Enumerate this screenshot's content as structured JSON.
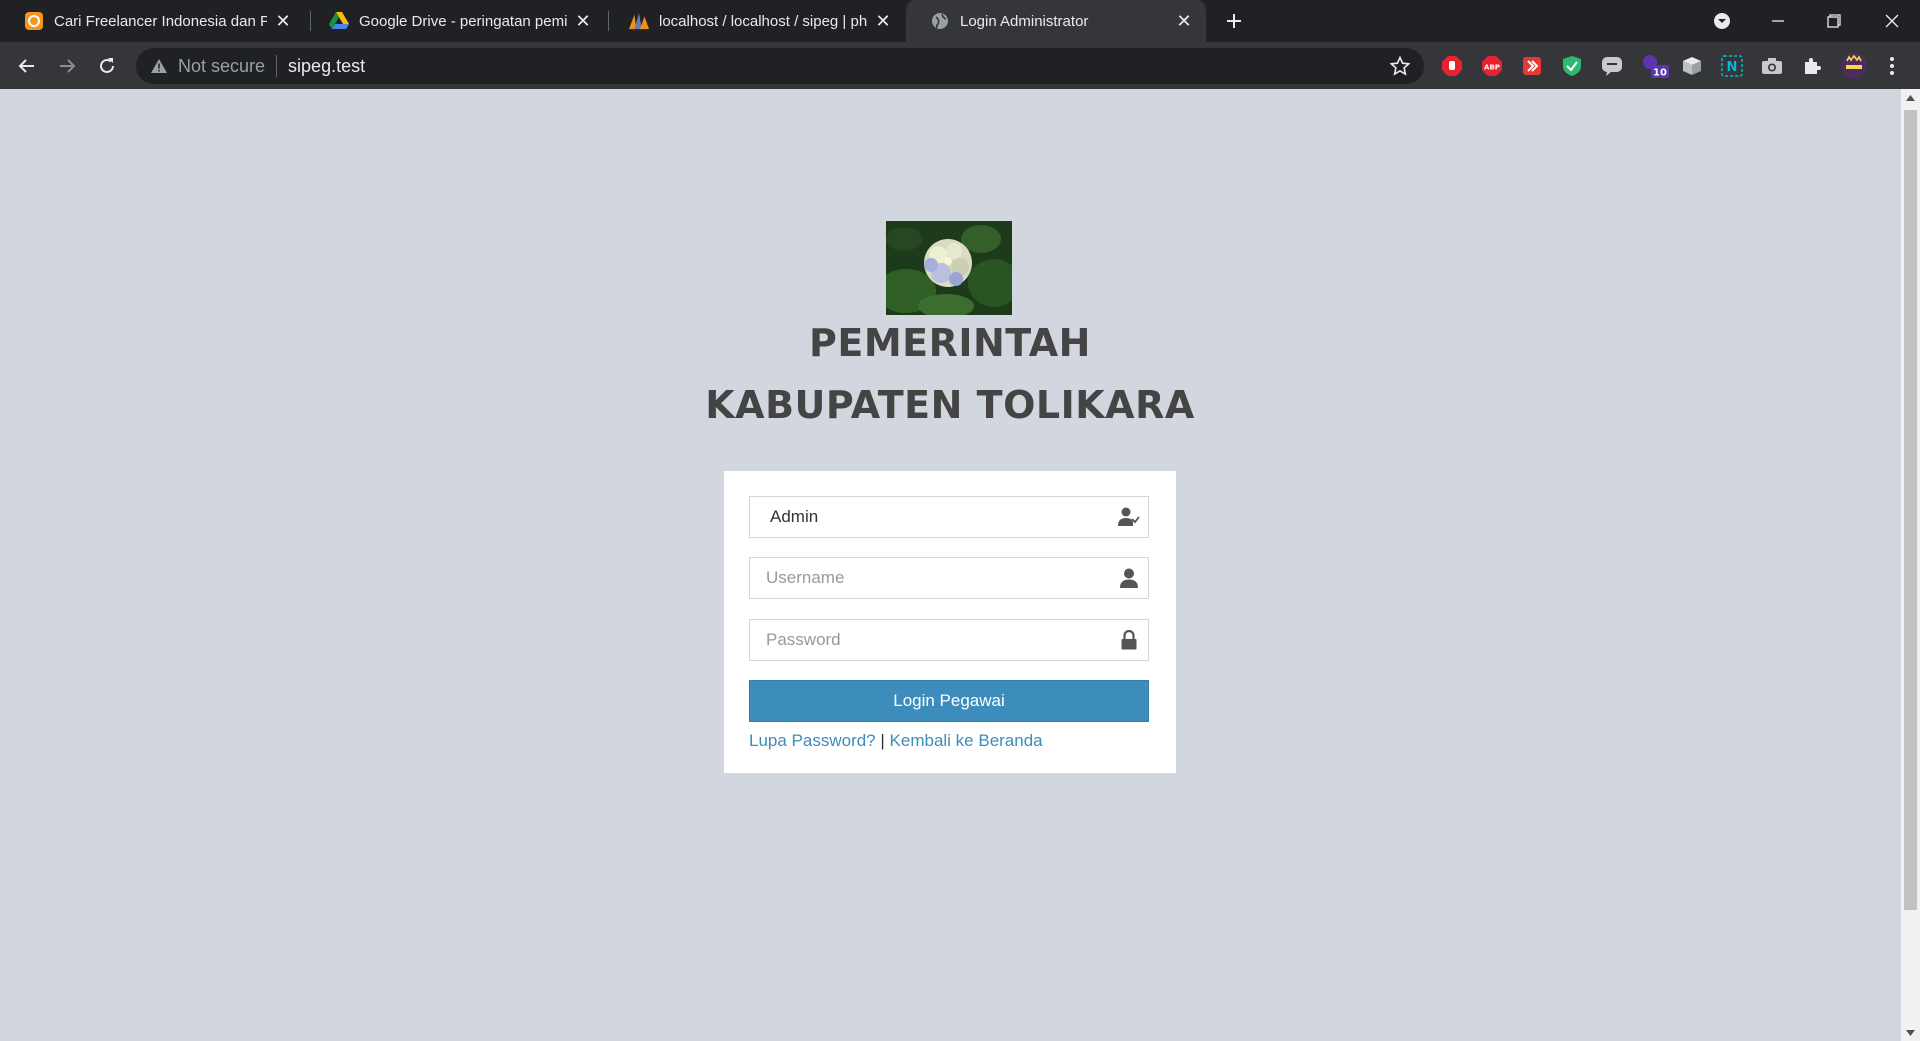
{
  "browser": {
    "tabs": [
      {
        "title": "Cari Freelancer Indonesia dan Pek",
        "active": false
      },
      {
        "title": "Google Drive - peringatan pemin",
        "active": false
      },
      {
        "title": "localhost / localhost / sipeg | php",
        "active": false
      },
      {
        "title": "Login Administrator",
        "active": true
      }
    ],
    "omnibox": {
      "security": "Not secure",
      "url": "sipeg.test"
    },
    "extension_badge": "10"
  },
  "page": {
    "header": {
      "line1": "PEMERINTAH",
      "line2": "KABUPATEN TOLIKARA"
    },
    "login": {
      "role_value": "Admin",
      "username_placeholder": "Username",
      "password_placeholder": "Password",
      "submit_label": "Login Pegawai",
      "forgot_label": "Lupa Password?",
      "separator": "|",
      "back_label": "Kembali ke Beranda"
    }
  },
  "colors": {
    "background": "#d2d6de",
    "primary": "#3c8dbc",
    "box": "#ffffff"
  }
}
